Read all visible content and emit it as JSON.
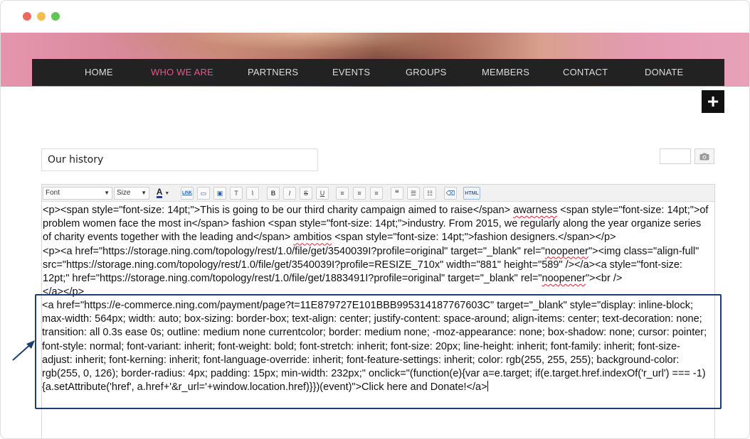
{
  "window": {
    "traffic_lights": [
      "#ed6a5e",
      "#f5bf4f",
      "#62c554"
    ]
  },
  "nav": {
    "items": [
      {
        "label": "HOME",
        "active": false
      },
      {
        "label": "WHO WE ARE",
        "active": true
      },
      {
        "label": "PARTNERS",
        "active": false
      },
      {
        "label": "EVENTS",
        "active": false
      },
      {
        "label": "GROUPS",
        "active": false
      },
      {
        "label": "MEMBERS",
        "active": false
      },
      {
        "label": "CONTACT",
        "active": false
      },
      {
        "label": "DONATE",
        "active": false
      }
    ],
    "active_color": "#e8528d"
  },
  "add_button": {
    "symbol": "+"
  },
  "post": {
    "title_value": "Our history"
  },
  "toolbar": {
    "font_select": "Font",
    "size_select": "Size",
    "buttons": [
      {
        "icon": "text-color-icon",
        "glyph": "A"
      },
      {
        "icon": "link-icon",
        "glyph": "LINK"
      },
      {
        "icon": "image-icon",
        "glyph": "▭"
      },
      {
        "icon": "video-icon",
        "glyph": "▣"
      },
      {
        "icon": "text-box-icon",
        "glyph": "T"
      },
      {
        "icon": "attach-icon",
        "glyph": "⌇"
      },
      {
        "icon": "bold-icon",
        "glyph": "B"
      },
      {
        "icon": "italic-icon",
        "glyph": "I"
      },
      {
        "icon": "strikethrough-icon",
        "glyph": "S"
      },
      {
        "icon": "underline-icon",
        "glyph": "U"
      },
      {
        "icon": "align-left-icon",
        "glyph": "≡"
      },
      {
        "icon": "align-center-icon",
        "glyph": "≡"
      },
      {
        "icon": "align-right-icon",
        "glyph": "≡"
      },
      {
        "icon": "quote-icon",
        "glyph": "“"
      },
      {
        "icon": "bullet-list-icon",
        "glyph": "☰"
      },
      {
        "icon": "numbered-list-icon",
        "glyph": "☷"
      },
      {
        "icon": "eraser-icon",
        "glyph": "⌫"
      },
      {
        "icon": "html-icon",
        "glyph": "HTML"
      }
    ]
  },
  "code": {
    "p1_a": "<p><span style=\"font-size: 14pt;\">This is going to be our third charity campaign aimed to raise</span> ",
    "p1_w1": "awarness",
    "p1_b": " <span style=\"font-size: 14pt;\">of problem women face the most in</span> fashion <span style=\"font-size: 14pt;\">industry. From 2015, we regularly along the year organize series of charity events together with the leading and</span> ",
    "p1_w2": "ambitios",
    "p1_c": " <span style=\"font-size: 14pt;\">fashion designers.</span></p>",
    "p2_a": "<p><a href=\"https://storage.ning.com/topology/rest/1.0/file/get/3540039I?profile=original\" target=\"_blank\" rel=\"",
    "p2_w1": "noopener",
    "p2_b": "\"><img class=\"align-full\" src=\"https://storage.ning.com/topology/rest/1.0/file/get/3540039I?profile=RESIZE_710x\" width=\"881\" height=\"589\" /></a><a style=\"font-size: 12pt;\" href=\"https://storage.ning.com/topology/rest/1.0/file/get/1883491I?profile=original\" target=\"_blank\" rel=\"",
    "p2_w2": "noopener",
    "p2_c": "\"><br />",
    "p3": " </a></p>",
    "donate_html": "<a href=\"https://e-commerce.ning.com/payment/page?t=11E879727E101BBB995314187767603C\" target=\"_blank\" style=\"display: inline-block; max-width: 564px; width: auto; box-sizing: border-box; text-align: center; justify-content: space-around; align-items: center; text-decoration: none; transition: all 0.3s ease 0s; outline: medium none currentcolor; border: medium none; -moz-appearance: none; box-shadow: none; cursor: pointer; font-style: normal; font-variant: inherit; font-weight: bold; font-stretch: inherit; font-size: 20px; line-height: inherit; font-family: inherit; font-size-adjust: inherit; font-kerning: inherit; font-language-override: inherit; font-feature-settings: inherit; color: rgb(255, 255, 255); background-color: rgb(255, 0, 126); border-radius: 4px; padding: 15px; min-width: 232px;\" onclick=\"(function(e){var a=e.target; if(e.target.href.indexOf('r_url') === -1){a.setAttribute('href', a.href+'&r_url='+window.location.href)}})(event)\">Click here and Donate!</a>"
  },
  "annotation": {
    "highlight_color": "#1b3f6f"
  }
}
